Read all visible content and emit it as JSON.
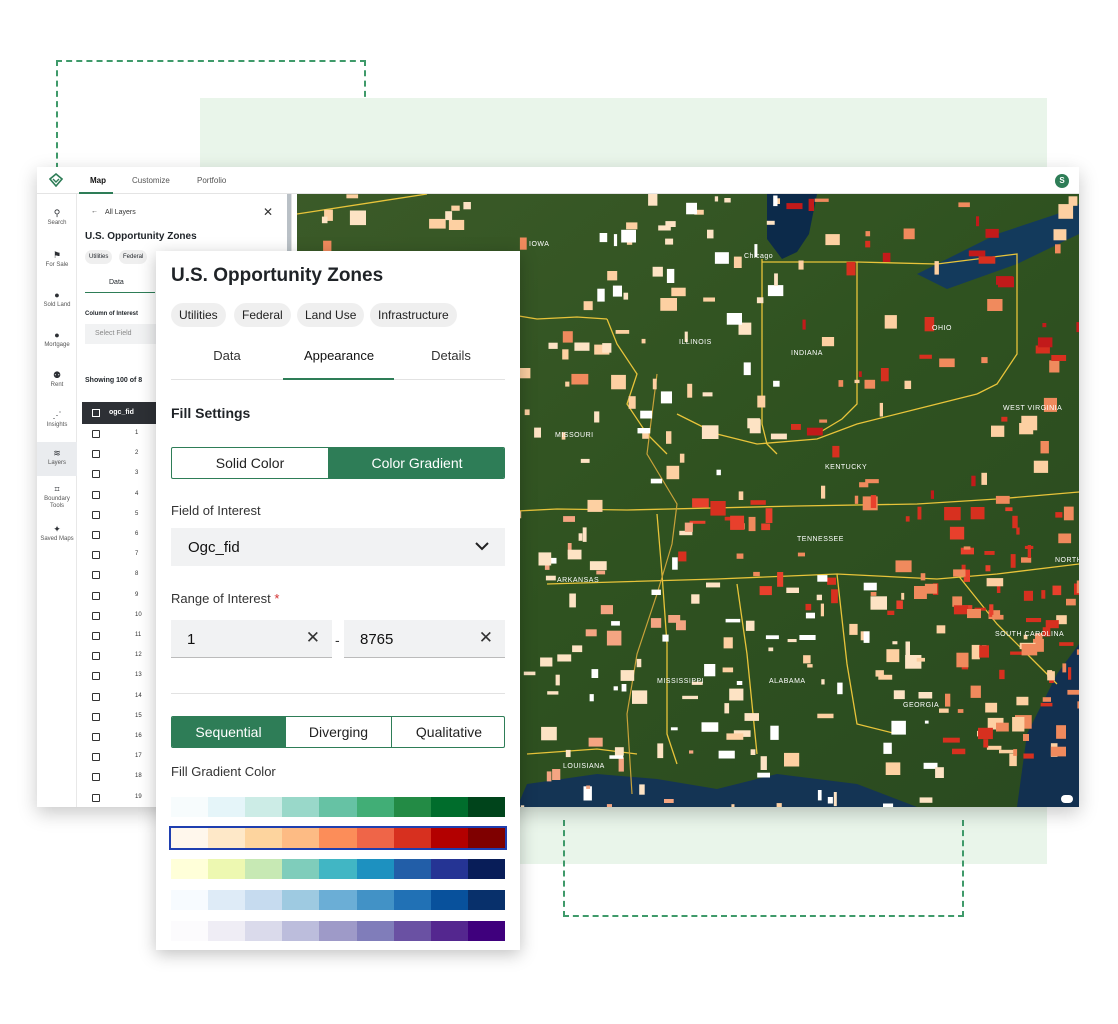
{
  "topbar": {
    "tabs": [
      "Map",
      "Customize",
      "Portfolio"
    ],
    "avatar_initial": "S"
  },
  "nav": {
    "items": [
      {
        "icon": "search-icon",
        "label": "Search"
      },
      {
        "icon": "for-sale-icon",
        "label": "For Sale"
      },
      {
        "icon": "sold-land-icon",
        "label": "Sold Land"
      },
      {
        "icon": "mortgage-icon",
        "label": "Mortgage"
      },
      {
        "icon": "rent-icon",
        "label": "Rent"
      },
      {
        "icon": "insights-icon",
        "label": "Insights"
      },
      {
        "icon": "layers-icon",
        "label": "Layers"
      },
      {
        "icon": "boundary-tools-icon",
        "label": "Boundary Tools"
      },
      {
        "icon": "saved-maps-icon",
        "label": "Saved Maps"
      }
    ],
    "active": "Layers"
  },
  "panel": {
    "back_label": "All Layers",
    "title": "U.S. Opportunity Zones",
    "chips": [
      "Utilities",
      "Federal"
    ],
    "tab": "Data",
    "column_label": "Column of Interest",
    "select_placeholder": "Select Field",
    "showing": "Showing 100 of 8",
    "col_header": "ogc_fid",
    "rows": [
      "1",
      "2",
      "3",
      "4",
      "5",
      "6",
      "7",
      "8",
      "9",
      "10",
      "11",
      "12",
      "13",
      "14",
      "15",
      "16",
      "17",
      "18",
      "19"
    ]
  },
  "popup": {
    "title": "U.S. Opportunity Zones",
    "chips": [
      "Utilities",
      "Federal",
      "Land Use",
      "Infrastructure"
    ],
    "tabs": [
      "Data",
      "Appearance",
      "Details"
    ],
    "active_tab": "Appearance",
    "fill_settings": "Fill Settings",
    "fill_modes": [
      "Solid Color",
      "Color Gradient"
    ],
    "active_fill_mode": "Color Gradient",
    "field_label": "Field of Interest",
    "field_value": "Ogc_fid",
    "range_label": "Range of Interest",
    "range_required": "*",
    "range_min": "1",
    "range_sep": "-",
    "range_max": "8765",
    "scheme_types": [
      "Sequential",
      "Diverging",
      "Qualitative"
    ],
    "active_scheme": "Sequential",
    "gradient_label": "Fill Gradient Color",
    "gradients": [
      [
        "#f7fcfd",
        "#e5f5f9",
        "#ccece6",
        "#99d8c9",
        "#66c2a4",
        "#41ae76",
        "#238b45",
        "#006d2c",
        "#00441b"
      ],
      [
        "#fff7ec",
        "#fee8c8",
        "#fdd49e",
        "#fdbb84",
        "#fc8d59",
        "#ef6548",
        "#d7301f",
        "#b30000",
        "#7f0000"
      ],
      [
        "#ffffd9",
        "#edf8b1",
        "#c7e9b4",
        "#7fcdbb",
        "#41b6c4",
        "#1d91c0",
        "#225ea8",
        "#253494",
        "#081d58"
      ],
      [
        "#f7fbff",
        "#deebf7",
        "#c6dbef",
        "#9ecae1",
        "#6baed6",
        "#4292c6",
        "#2171b5",
        "#08519c",
        "#08306b"
      ],
      [
        "#fcfbfd",
        "#efedf5",
        "#dadaeb",
        "#bcbddc",
        "#9e9ac8",
        "#807dba",
        "#6a51a3",
        "#54278f",
        "#3f007d"
      ]
    ],
    "selected_gradient": 1
  },
  "map": {
    "labels": [
      "IOWA",
      "Chicago",
      "ILLINOIS",
      "INDIANA",
      "OHIO",
      "WEST VIRGINIA",
      "MISSOURI",
      "KENTUCKY",
      "TENNESSEE",
      "ARKANSAS",
      "MISSISSIPPI",
      "ALABAMA",
      "GEORGIA",
      "SOUTH CAROLINA",
      "LOUISIANA",
      "NORTH CAROLINA"
    ]
  },
  "colors": {
    "accent": "#2e7d57",
    "dash": "#3f9a6a",
    "required": "#d32f2f"
  }
}
